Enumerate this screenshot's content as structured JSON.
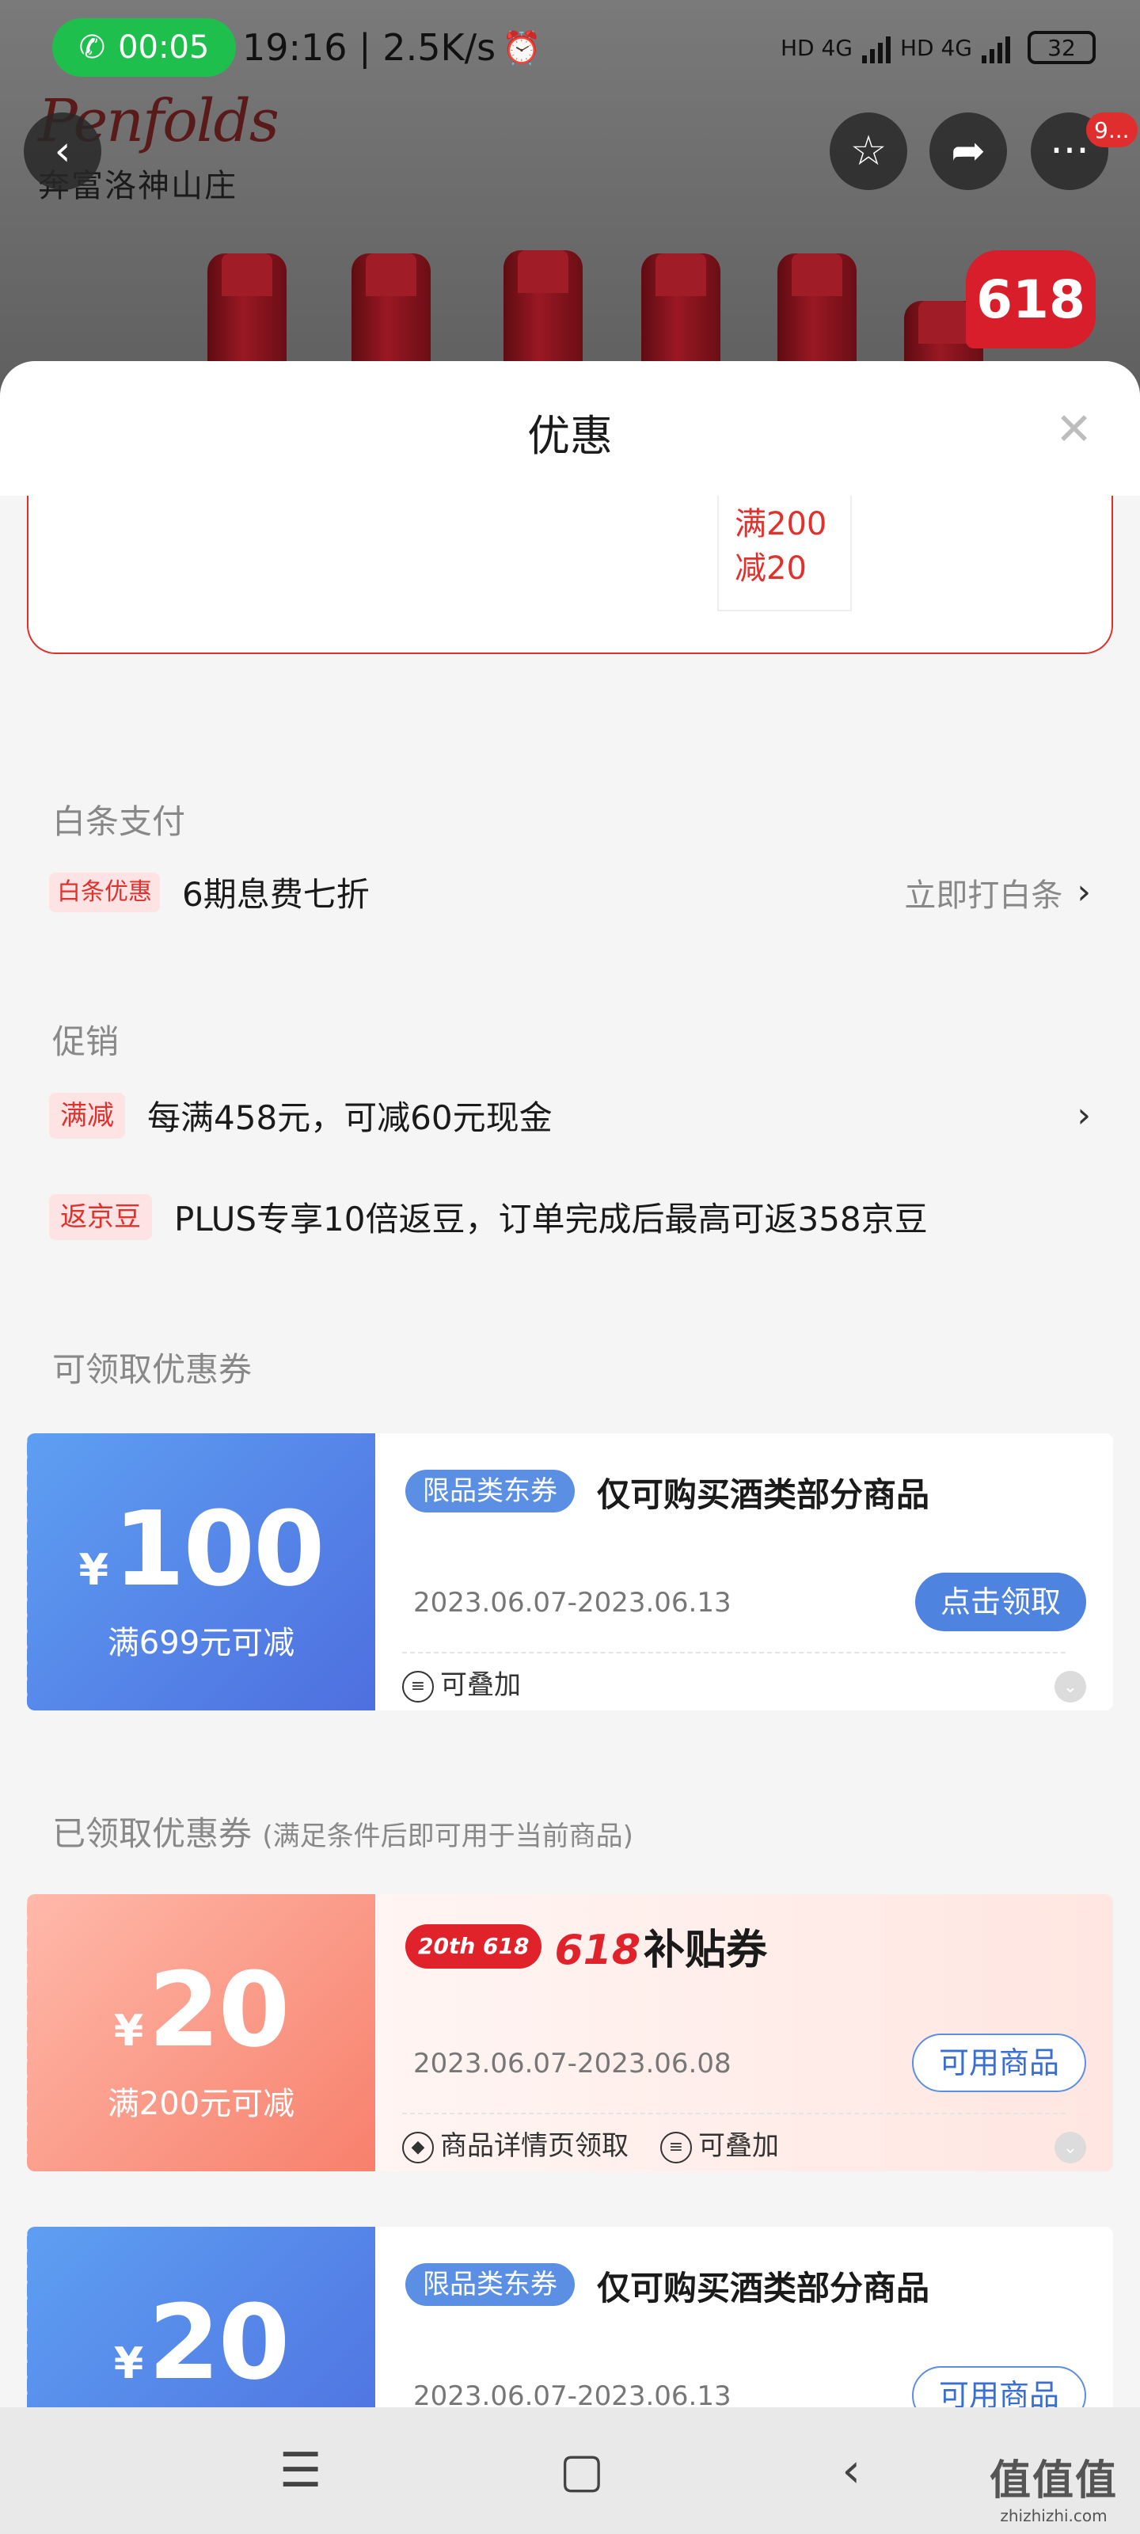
{
  "status_bar": {
    "call_time": "00:05",
    "clock_speed": "19:16 | 2.5K/s",
    "network_1": "HD 4G",
    "network_2": "HD 4G",
    "battery": "32"
  },
  "header": {
    "brand_script": "Penfolds",
    "brand_cn": "奔富洛神山庄",
    "badge": "618",
    "message_count": "9..."
  },
  "sheet": {
    "title": "优惠",
    "partial_coupon": {
      "line1": "满200",
      "line2": "减20"
    }
  },
  "baitiao": {
    "section_title": "白条支付",
    "tag": "白条优惠",
    "text": "6期息费七折",
    "action": "立即打白条"
  },
  "promotion": {
    "section_title": "促销",
    "items": [
      {
        "tag": "满减",
        "text": "每满458元，可减60元现金"
      },
      {
        "tag": "返京豆",
        "text": "PLUS专享10倍返豆，订单完成后最高可返358京豆"
      }
    ]
  },
  "available_coupons": {
    "section_title": "可领取优惠券",
    "items": [
      {
        "yen": "¥",
        "amount": "100",
        "condition": "满699元可减",
        "category_tag": "限品类东券",
        "category_text": "仅可购买酒类部分商品",
        "date": "2023.06.07-2023.06.13",
        "button": "点击领取",
        "feature": "可叠加"
      }
    ]
  },
  "claimed_coupons": {
    "section_title": "已领取优惠券",
    "section_note": "(满足条件后即可用于当前商品)",
    "items": [
      {
        "yen": "¥",
        "amount": "20",
        "condition": "满200元可减",
        "promo_pill": "20th 618",
        "promo_red": "618",
        "promo_text": "补贴券",
        "date": "2023.06.07-2023.06.08",
        "button": "可用商品",
        "feature_1": "商品详情页领取",
        "feature_2": "可叠加"
      },
      {
        "yen": "¥",
        "amount": "20",
        "category_tag": "限品类东券",
        "category_text": "仅可购买酒类部分商品",
        "date": "2023.06.07-2023.06.13",
        "button": "可用商品"
      }
    ]
  },
  "watermark": {
    "line1": "值值值",
    "line2": "zhizhizhi.com"
  },
  "icons": {
    "back": "back-icon",
    "favorite": "star-icon",
    "share": "share-icon",
    "more": "more-icon",
    "close": "close-icon",
    "chevron": "chevron-right-icon",
    "stack": "stack-icon",
    "ticket": "ticket-icon",
    "expand": "chevron-down-icon"
  },
  "colors": {
    "accent_red": "#e0312c",
    "coupon_blue": "#4f83e0",
    "call_green": "#1fbf4e"
  }
}
